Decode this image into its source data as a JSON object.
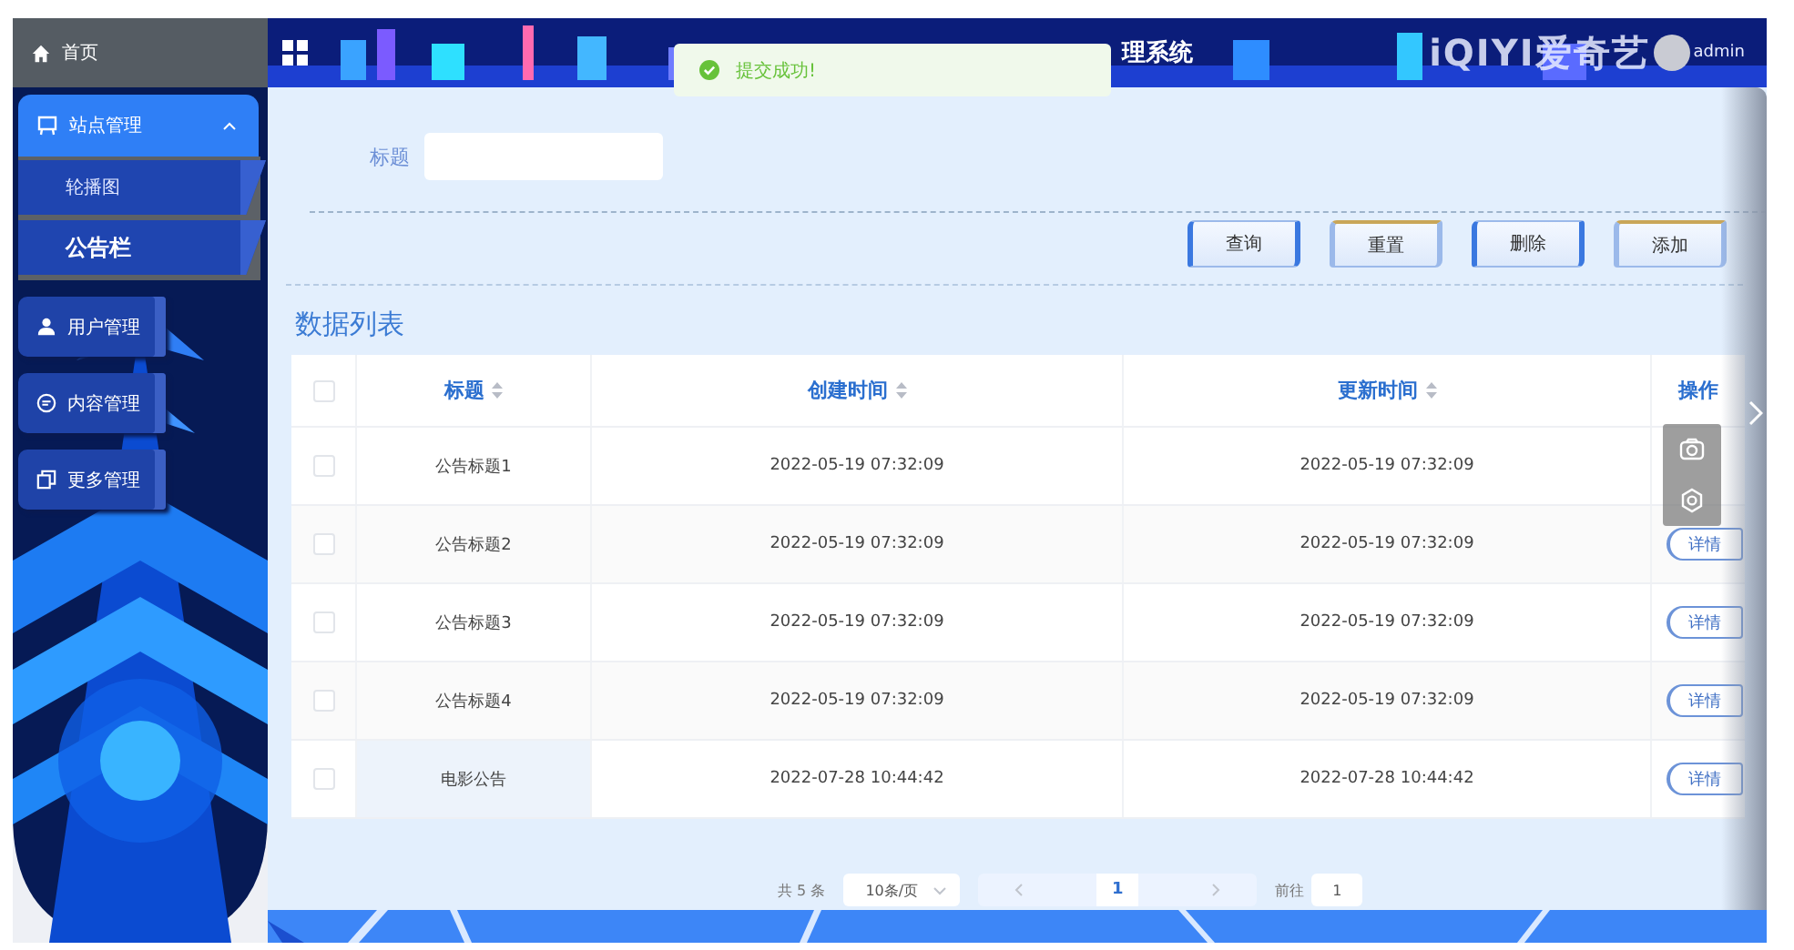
{
  "sidebar": {
    "items": [
      {
        "label": "首页",
        "kind": "link"
      },
      {
        "label": "站点管理",
        "kind": "group",
        "expanded": true,
        "children": [
          {
            "label": "轮播图",
            "selected": false
          },
          {
            "label": "公告栏",
            "selected": true
          }
        ]
      },
      {
        "label": "用户管理",
        "kind": "group",
        "expanded": false
      },
      {
        "label": "内容管理",
        "kind": "group",
        "expanded": false
      },
      {
        "label": "更多管理",
        "kind": "group",
        "expanded": false
      }
    ]
  },
  "header": {
    "title": "理系统",
    "logo": "iQIYI爱奇艺",
    "user": "admin"
  },
  "toast": {
    "message": "提交成功!"
  },
  "search": {
    "label": "标题"
  },
  "buttons": [
    "查询",
    "重置",
    "删除",
    "添加"
  ],
  "table": {
    "title": "数据列表",
    "all_checked": false,
    "columns": [
      {
        "label": "标题",
        "sortable": true
      },
      {
        "label": "创建时间",
        "sortable": true
      },
      {
        "label": "更新时间",
        "sortable": true
      },
      {
        "label": "操作",
        "sortable": false
      }
    ],
    "rows": [
      {
        "checked": false,
        "hovered": false,
        "cells": [
          "公告标题1",
          "2022-05-19 07:32:09",
          "2022-05-19 07:32:09"
        ]
      },
      {
        "checked": false,
        "hovered": false,
        "cells": [
          "公告标题2",
          "2022-05-19 07:32:09",
          "2022-05-19 07:32:09"
        ],
        "action": "详情"
      },
      {
        "checked": false,
        "hovered": false,
        "cells": [
          "公告标题3",
          "2022-05-19 07:32:09",
          "2022-05-19 07:32:09"
        ],
        "action": "详情"
      },
      {
        "checked": false,
        "hovered": false,
        "cells": [
          "公告标题4",
          "2022-05-19 07:32:09",
          "2022-05-19 07:32:09"
        ],
        "action": "详情"
      },
      {
        "checked": false,
        "hovered": true,
        "cells": [
          "电影公告",
          "2022-07-28 10:44:42",
          "2022-07-28 10:44:42"
        ],
        "action": "详情"
      }
    ]
  },
  "pagination": {
    "total": "共 5 条",
    "page_size": "10条/页",
    "pages": [
      {
        "label": "1",
        "selected": true
      }
    ],
    "jump_label": "前往",
    "jump_value": "1"
  }
}
